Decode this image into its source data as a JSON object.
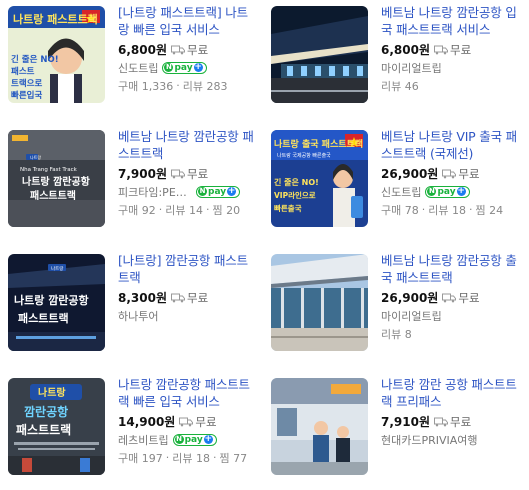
{
  "products": [
    {
      "title": "[나트랑 패스트트랙] 나트랑 빠른 입국 서비스",
      "price": "6,800원",
      "shipping": "무료",
      "seller": "신도트립",
      "npay": true,
      "stats": [
        "구매 1,336",
        "리뷰 283"
      ]
    },
    {
      "title": "베트남 나트랑 깜란공항 입국 패스트트랙 서비스",
      "price": "6,800원",
      "shipping": "무료",
      "seller": "마이리얼트립",
      "npay": false,
      "stats": [
        "리뷰 46"
      ]
    },
    {
      "title": "베트남 나트랑 깜란공항 패스트트랙",
      "price": "7,900원",
      "shipping": "무료",
      "seller": "피크타임:PEAKTIME",
      "npay": true,
      "stats": [
        "구매 92",
        "리뷰 14",
        "찜 20"
      ]
    },
    {
      "title": "베트남 나트랑 VIP 출국 패스트트랙 (국제선)",
      "price": "26,900원",
      "shipping": "무료",
      "seller": "신도트립",
      "npay": true,
      "stats": [
        "구매 78",
        "리뷰 18",
        "찜 24"
      ]
    },
    {
      "title": "[나트랑] 깜란공항 패스트트랙",
      "price": "8,300원",
      "shipping": "무료",
      "seller": "하나투어",
      "npay": false,
      "stats": []
    },
    {
      "title": "베트남 나트랑 깜란공항 출국 패스트트랙",
      "price": "26,900원",
      "shipping": "무료",
      "seller": "마이리얼트립",
      "npay": false,
      "stats": [
        "리뷰 8"
      ]
    },
    {
      "title": "나트랑 깜란공항 패스트트랙 빠른 입국 서비스",
      "price": "14,900원",
      "shipping": "무료",
      "seller": "레츠비트립",
      "npay": true,
      "stats": [
        "구매 197",
        "리뷰 18",
        "찜 77"
      ]
    },
    {
      "title": "나트랑 깜란 공항 패스트트랙 프리패스",
      "price": "7,910원",
      "shipping": "무료",
      "seller": "현대카드PRIVIA여행",
      "npay": false,
      "stats": []
    }
  ],
  "thumb_text": {
    "t1": [
      "나트랑 패스트트랙",
      "긴 줄은 NO!",
      "패스트",
      "트랙으로",
      "빠른입국"
    ],
    "t3": [
      "Nha Trang Fast Track",
      "나트랑 깜란공항",
      "패스트트랙"
    ],
    "t4": [
      "나트랑 출국 패스트트랙",
      "나트랑 국제공항 빠른출국",
      "긴 줄은 NO!",
      "VIP라인으로",
      "빠른출국"
    ],
    "t5": [
      "나트랑 깜란공항",
      "패스트트랙"
    ],
    "t7": [
      "나트랑",
      "깜란공항",
      "패스트트랙"
    ]
  },
  "npay_label": "pay",
  "colors": {
    "title": "#2e55c4",
    "npay": "#19b23c",
    "plus": "#1b7cf0"
  }
}
